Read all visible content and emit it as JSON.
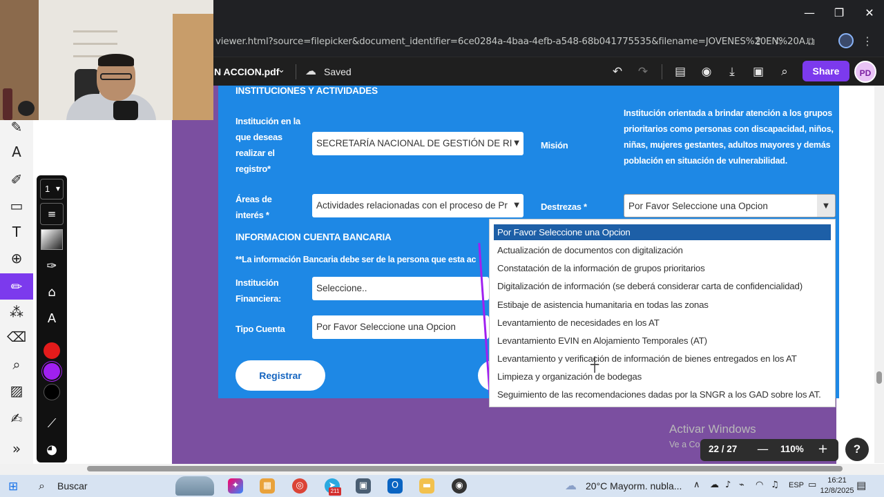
{
  "browser": {
    "url": "viewer.html?source=filepicker&document_identifier=6ce0284a-4baa-4efb-a548-68b041775535&filename=JOVENES%20EN%20A...",
    "window_controls": [
      "—",
      "❐",
      "✕"
    ]
  },
  "toolbar": {
    "doc_name": "N ACCION.pdf",
    "saved_label": "Saved",
    "share_label": "Share",
    "avatar_initials": "PD",
    "icons": [
      "undo-icon",
      "redo-icon",
      "document-icon",
      "eye-icon",
      "download-icon",
      "toolbox-icon",
      "search-icon"
    ]
  },
  "form": {
    "section_institutions": "INSTITUCIONES Y ACTIVIDADES",
    "label_institution": "Institución en la que deseas realizar el registro*",
    "institution_value": "SECRETARÍA NACIONAL DE GESTIÓN DE RI",
    "label_mission": "Misión",
    "mission_text": "Institución orientada a brindar atención a los grupos prioritarios como personas con discapacidad, niños, niñas, mujeres gestantes, adultos mayores y demás población en situación de vulnerabilidad.",
    "label_areas": "Áreas de interés *",
    "areas_value": "Actividades relacionadas con el proceso de Pr",
    "label_skills": "Destrezas *",
    "skills_value": "Por Favor Seleccione una Opcion",
    "section_bank": "INFORMACION CUENTA BANCARIA",
    "bank_note": "**La información Bancaria debe ser de la persona que esta ac",
    "label_fin_inst": "Institución Financiera:",
    "fin_inst_value": "Seleccione..",
    "label_account_type": "Tipo Cuenta",
    "account_type_value": "Por Favor Seleccione una Opcion",
    "register_label": "Registrar"
  },
  "dropdown": {
    "options": [
      "Por Favor Seleccione una Opcion",
      "Actualización de documentos con digitalización",
      "Constatación de la información de grupos prioritarios",
      "Digitalización de información (se deberá considerar carta de confidencialidad)",
      "Estibaje de asistencia humanitaria en todas las zonas",
      "Levantamiento de necesidades en los AT",
      "Levantamiento EVIN en Alojamiento Temporales (AT)",
      "Levantamiento y verificación de información de bienes entregados en los AT",
      "Limpieza y organización de bodegas",
      "Seguimiento de las recomendaciones dadas por la SNGR a los GAD sobre los AT."
    ],
    "selected_index": 0
  },
  "watermark": {
    "line1": "Activar Windows",
    "line2": "Ve a Configuración para activar Windows."
  },
  "page_control": {
    "page": "22 / 27",
    "zoom": "110%",
    "minus": "—",
    "plus": "+",
    "help": "?"
  },
  "draw_panel": {
    "stroke_size": "1",
    "colors": [
      "#e31b1b",
      "#a020f0",
      "#000000"
    ]
  },
  "taskbar": {
    "search_label": "Buscar",
    "weather": "20°C  Mayorm. nubla...",
    "language": "ESP",
    "time": "16:21",
    "date": "12/8/2025",
    "mail_badge": "211",
    "notif_count": "4"
  },
  "colors": {
    "accent": "#7c3aed",
    "form_blue": "#1e88e5",
    "page_purple": "#7b4fa0",
    "selected_option": "#1d5fa7"
  }
}
